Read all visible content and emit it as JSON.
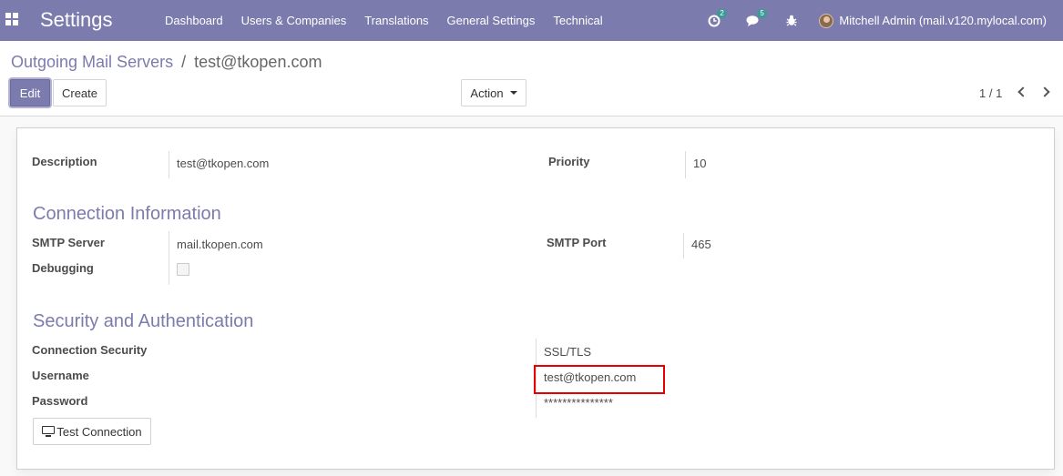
{
  "navbar": {
    "app_title": "Settings",
    "menu": [
      "Dashboard",
      "Users & Companies",
      "Translations",
      "General Settings",
      "Technical"
    ],
    "activity_count": "2",
    "messages_count": "5",
    "user_label": "Mitchell Admin (mail.v120.mylocal.com)"
  },
  "breadcrumb": {
    "parent": "Outgoing Mail Servers",
    "separator": "/",
    "current": "test@tkopen.com"
  },
  "buttons": {
    "edit": "Edit",
    "create": "Create",
    "action": "Action",
    "test_connection": "Test Connection"
  },
  "pager": {
    "value": "1 / 1"
  },
  "form": {
    "description_label": "Description",
    "description_value": "test@tkopen.com",
    "priority_label": "Priority",
    "priority_value": "10",
    "connection_section": "Connection Information",
    "smtp_server_label": "SMTP Server",
    "smtp_server_value": "mail.tkopen.com",
    "smtp_port_label": "SMTP Port",
    "smtp_port_value": "465",
    "debugging_label": "Debugging",
    "debugging_checked": false,
    "security_section": "Security and Authentication",
    "connection_security_label": "Connection Security",
    "connection_security_value": "SSL/TLS",
    "username_label": "Username",
    "username_value": "test@tkopen.com",
    "password_label": "Password",
    "password_value": "***************"
  },
  "colors": {
    "brand": "#7c7bad",
    "badge": "#3c9a95",
    "highlight": "#e60000"
  },
  "icons": [
    "apps-grid-icon",
    "activity-clock-icon",
    "chat-icon",
    "bug-icon",
    "avatar",
    "caret-down-icon",
    "chevron-left-icon",
    "chevron-right-icon",
    "monitor-icon"
  ]
}
